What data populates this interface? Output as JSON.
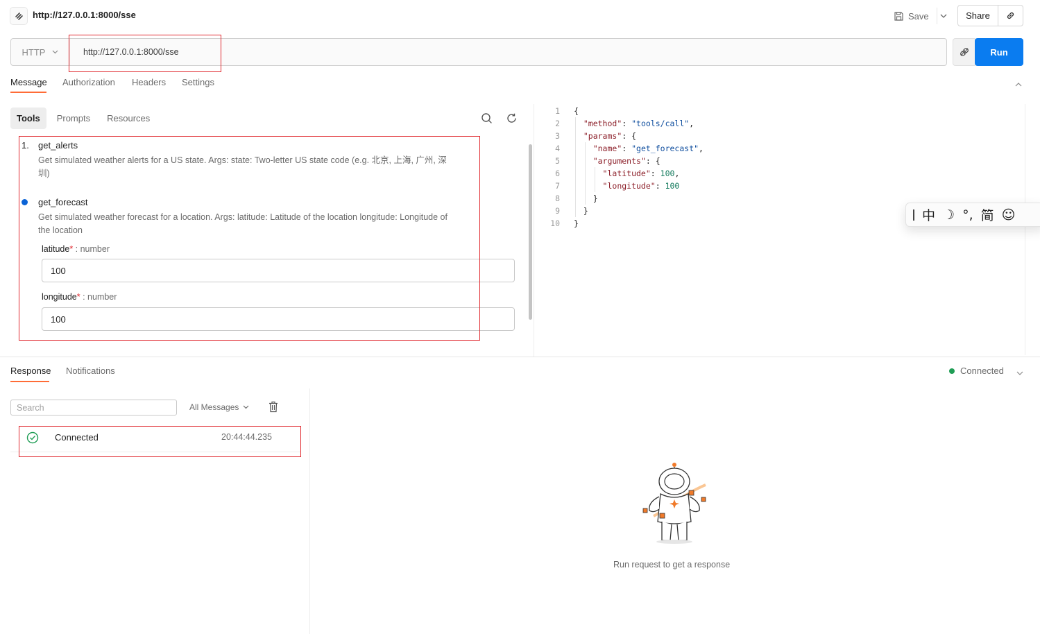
{
  "header": {
    "title": "http://127.0.0.1:8000/sse",
    "save_label": "Save",
    "share_label": "Share"
  },
  "request": {
    "method": "HTTP",
    "url": "http://127.0.0.1:8000/sse",
    "run_label": "Run"
  },
  "message_tabs": [
    "Message",
    "Authorization",
    "Headers",
    "Settings"
  ],
  "sub_tabs": [
    "Tools",
    "Prompts",
    "Resources"
  ],
  "tools": [
    {
      "number": "1.",
      "name": "get_alerts",
      "description": "Get simulated weather alerts for a US state. Args: state: Two-letter US state code (e.g. 北京, 上海, 广州, 深圳)"
    },
    {
      "name": "get_forecast",
      "description": "Get simulated weather forecast for a location. Args: latitude: Latitude of the location longitude: Longitude of the location",
      "params": [
        {
          "name": "latitude",
          "required_mark": "*",
          "type": " : number",
          "value": "100"
        },
        {
          "name": "longitude",
          "required_mark": "*",
          "type": " : number",
          "value": "100"
        }
      ]
    }
  ],
  "code_lines": [
    "1",
    "2",
    "3",
    "4",
    "5",
    "6",
    "7",
    "8",
    "9",
    "10"
  ],
  "code": {
    "method_key": "\"method\"",
    "method_val": "\"tools/call\"",
    "params_key": "\"params\"",
    "name_key": "\"name\"",
    "name_val": "\"get_forecast\"",
    "arguments_key": "\"arguments\"",
    "latitude_key": "\"latitude\"",
    "latitude_val": "100",
    "longitude_key": "\"longitude\"",
    "longitude_val": "100"
  },
  "ime_toolbar": [
    "中",
    "☽",
    "°,",
    "简",
    "☺"
  ],
  "response": {
    "tabs": [
      "Response",
      "Notifications"
    ],
    "status": "Connected",
    "search_placeholder": "Search",
    "filter": "All Messages",
    "messages": [
      {
        "text": "Connected",
        "time": "20:44:44.235"
      }
    ],
    "empty_text": "Run request to get a response"
  },
  "colors": {
    "accent": "#ff6c37",
    "run_button": "#0a7cf0",
    "annotation_box": "#e0282e",
    "connected": "#1f9d55"
  }
}
